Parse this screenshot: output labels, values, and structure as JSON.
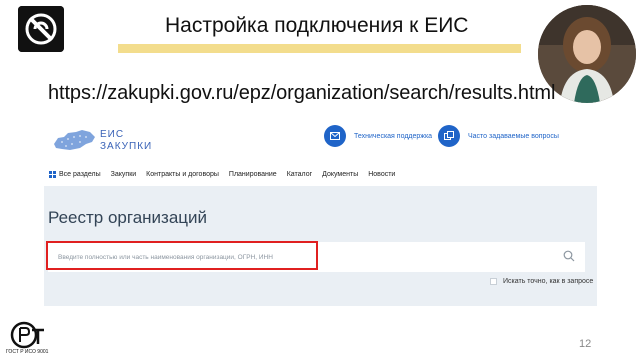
{
  "slide": {
    "title": "Настройка подключения к ЕИС",
    "url": "https://zakupki.gov.ru/epz/organization/search/results.html",
    "page_number": "12",
    "gost_label": "ГОСТ Р ИСО 9001"
  },
  "eis": {
    "brand_line1": "ЕИС",
    "brand_line2": "ЗАКУПКИ",
    "support_label": "Техническая поддержка",
    "faq_label": "Часто задаваемые вопросы",
    "nav": [
      "Все разделы",
      "Закупки",
      "Контракты и договоры",
      "Планирование",
      "Каталог",
      "Документы",
      "Новости"
    ],
    "registry_title": "Реестр организаций",
    "search_placeholder": "Введите полностью или часть наименования организации, ОГРН, ИНН",
    "exact_match_label": "Искать точно, как в запросе"
  },
  "colors": {
    "accent_bar": "#f3dd8d",
    "eis_blue": "#1f64c8",
    "highlight_red": "#e02020",
    "panel_bg": "#eaeff4"
  }
}
